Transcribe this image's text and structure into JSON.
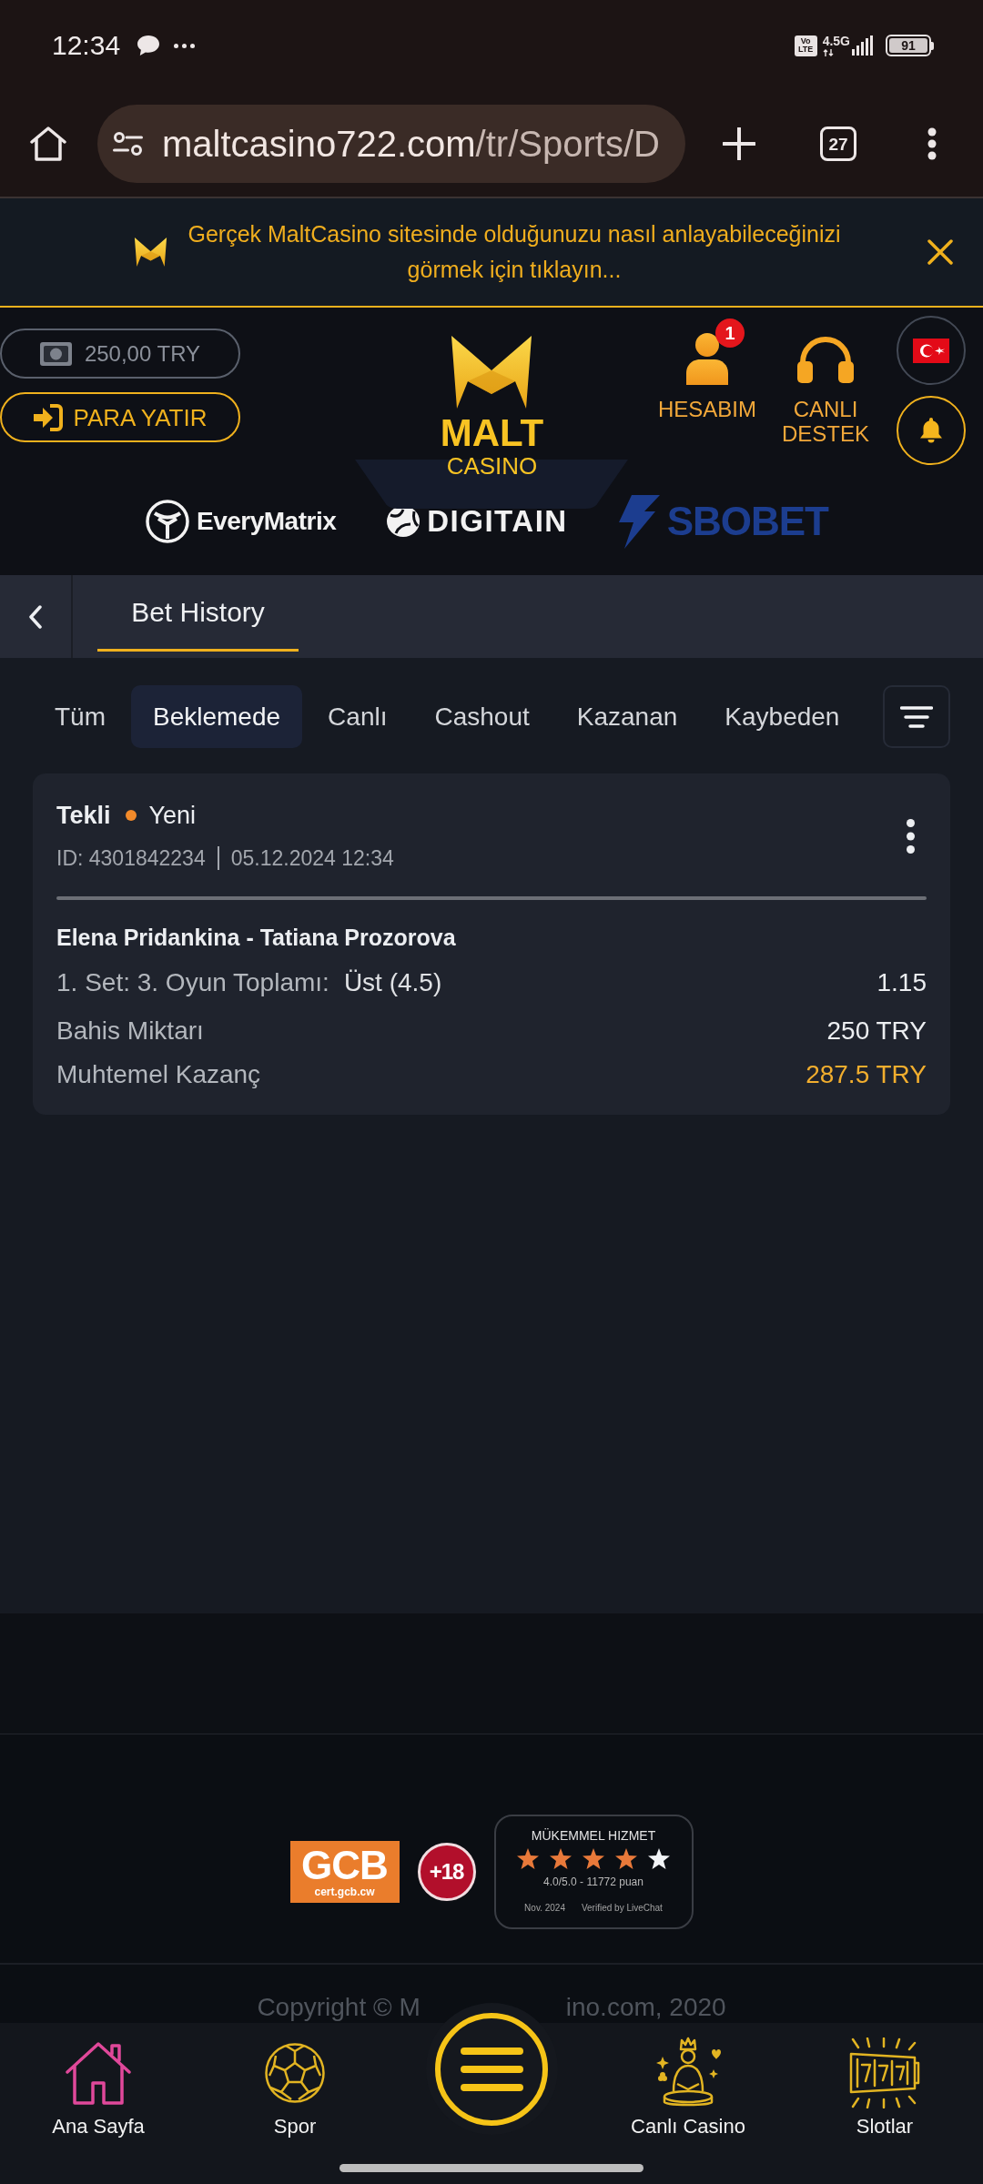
{
  "status_bar": {
    "time": "12:34",
    "volte_top": "Vo",
    "volte_bottom": "LTE",
    "network": "4.5G",
    "battery": "91"
  },
  "browser": {
    "url_host": "maltcasino722.com",
    "url_path": "/tr/Sports/D",
    "tab_count": "27"
  },
  "banner": {
    "text": "Gerçek MaltCasino sitesinde olduğunuzu nasıl anlayabileceğinizi görmek için tıklayın..."
  },
  "header": {
    "balance": "250,00 TRY",
    "deposit_button": "PARA YATIR",
    "logo_title": "MALT",
    "logo_subtitle": "CASINO",
    "account": {
      "label": "HESABIM",
      "badge": "1"
    },
    "support": {
      "label": "CANLI DESTEK"
    }
  },
  "providers": [
    {
      "kind": "ring",
      "name": "EveryMatrix"
    },
    {
      "kind": "sphere",
      "name": "DIGITAIN"
    },
    {
      "kind": "bolt",
      "name": "SBOBET"
    }
  ],
  "page_title": {
    "title": "Bet History"
  },
  "filter_tabs": [
    {
      "label": "Tüm",
      "selected": false
    },
    {
      "label": "Beklemede",
      "selected": true
    },
    {
      "label": "Canlı",
      "selected": false
    },
    {
      "label": "Cashout",
      "selected": false
    },
    {
      "label": "Kazanan",
      "selected": false
    },
    {
      "label": "Kaybeden",
      "selected": false
    }
  ],
  "bets": [
    {
      "type": "Tekli",
      "status": {
        "label": "Yeni",
        "color": "#f28a2a"
      },
      "id": "ID: 4301842234",
      "date": "05.12.2024 12:34",
      "match": "Elena Pridankina - Tatiana Prozorova",
      "market": "1. Set: 3. Oyun Toplamı:",
      "selection": "Üst (4.5)",
      "odds": "1.15",
      "amounts": [
        {
          "label": "Bahis Miktarı",
          "value": "250 TRY",
          "highlight": false
        },
        {
          "label": "Muhtemel Kazanç",
          "value": "287.5 TRY",
          "highlight": true
        }
      ]
    }
  ],
  "footer": {
    "license": {
      "title": "GCB",
      "url": "cert.gcb.cw"
    },
    "age_limit": "+18",
    "rating": {
      "title": "MÜKEMMEL HIZMET",
      "stars": 4,
      "score": "4.0/5.0 - 11772 puan",
      "date": "Nov. 2024",
      "verified": "Verified by LiveChat"
    },
    "copyright_left": "Copyright © M",
    "copyright_right": "ino.com, 2020"
  },
  "bottom_nav": [
    {
      "kind": "home",
      "label": "Ana Sayfa"
    },
    {
      "kind": "ball",
      "label": "Spor"
    },
    {
      "kind": "menu"
    },
    {
      "kind": "casino",
      "label": "Canlı Casino"
    },
    {
      "kind": "slots",
      "label": "Slotlar"
    }
  ]
}
